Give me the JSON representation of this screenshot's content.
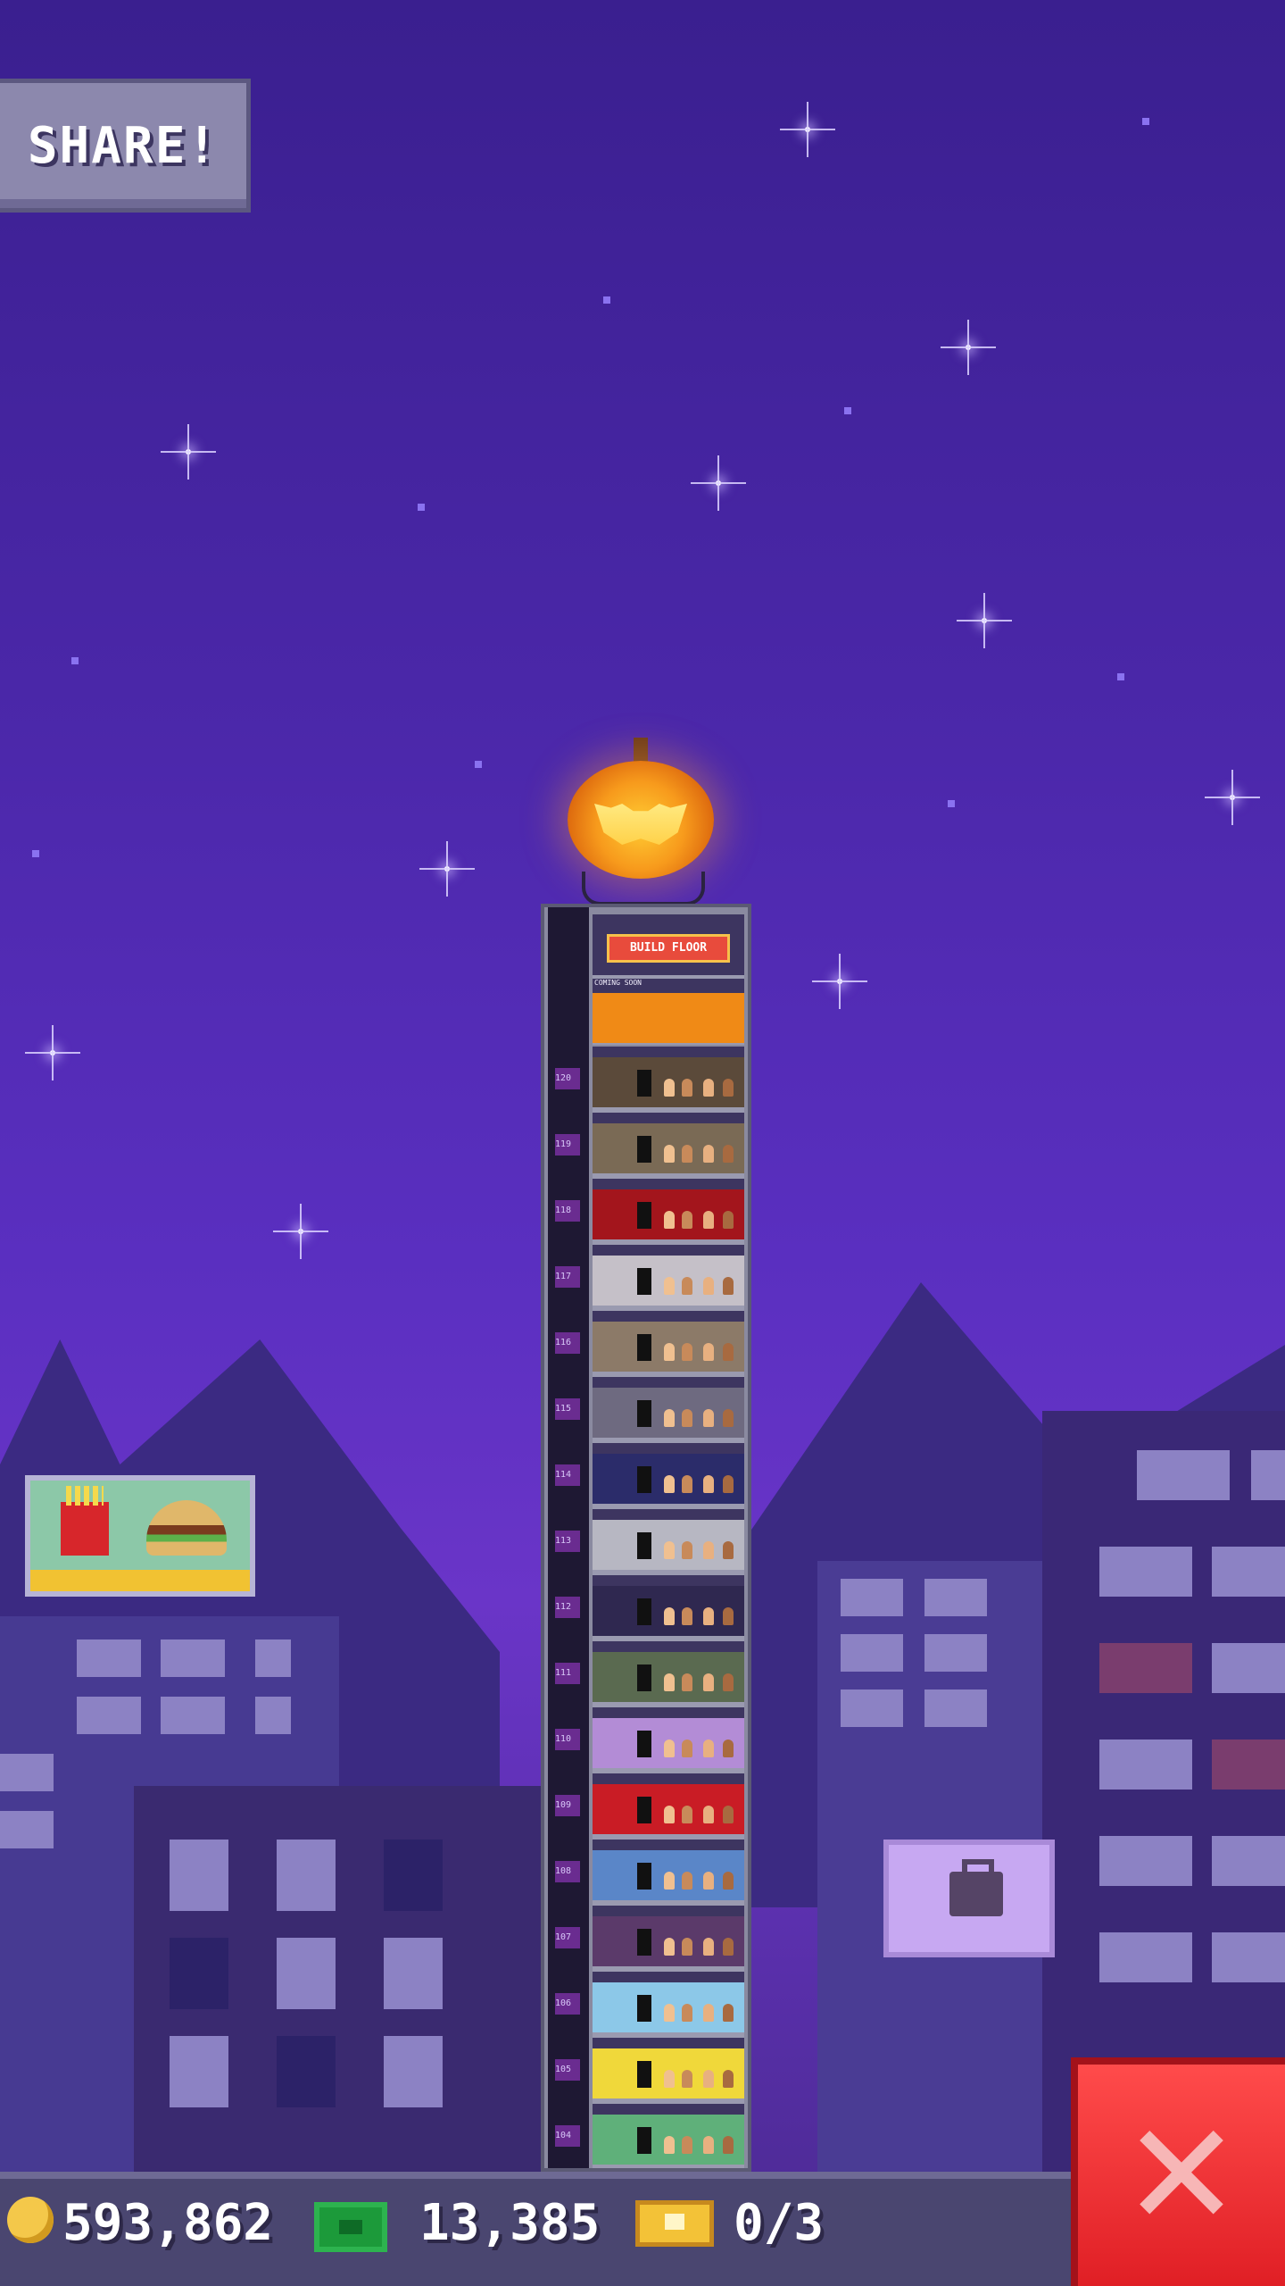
{
  "share_label": "SHARE!",
  "tower": {
    "build_floor_label": "BUILD FLOOR",
    "coming_soon_label": "COMING SOON",
    "floors": [
      {
        "num": "120",
        "color": "#5b4a3a"
      },
      {
        "num": "119",
        "color": "#7a6a55"
      },
      {
        "num": "118",
        "color": "#a3151c"
      },
      {
        "num": "117",
        "color": "#c5c0c8"
      },
      {
        "num": "116",
        "color": "#8c7a68"
      },
      {
        "num": "115",
        "color": "#6e6a80"
      },
      {
        "num": "114",
        "color": "#2b2c6a"
      },
      {
        "num": "113",
        "color": "#b7b7c2"
      },
      {
        "num": "112",
        "color": "#2f2850"
      },
      {
        "num": "111",
        "color": "#5a6a50"
      },
      {
        "num": "110",
        "color": "#b38cd6"
      },
      {
        "num": "109",
        "color": "#c91c25"
      },
      {
        "num": "108",
        "color": "#5a86c8"
      },
      {
        "num": "107",
        "color": "#5b3a6a"
      },
      {
        "num": "106",
        "color": "#8cc8e8"
      },
      {
        "num": "105",
        "color": "#f0d83a"
      },
      {
        "num": "104",
        "color": "#5fb07a"
      }
    ]
  },
  "status_bar": {
    "coins": "593,862",
    "bux": "13,385",
    "tickets": "0/3"
  },
  "colors": {
    "sky_top": "#3a1f8f",
    "close_button": "#e01f25",
    "coin": "#f4c84a",
    "bux": "#1c9a3a",
    "ticket": "#f3c237"
  },
  "icons": [
    "pumpkin-icon",
    "coin-icon",
    "bux-icon",
    "ticket-icon",
    "close-icon",
    "shopping-bag-icon"
  ]
}
